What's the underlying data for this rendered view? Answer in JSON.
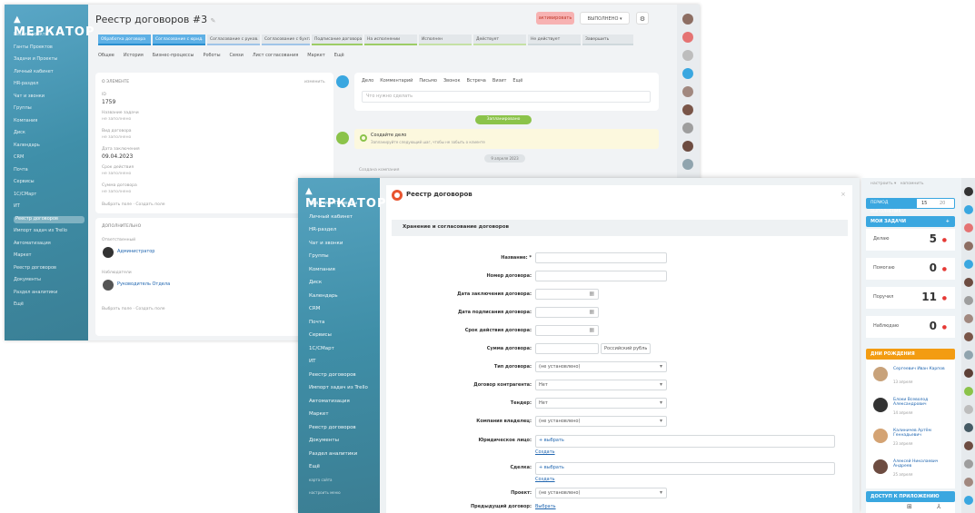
{
  "brand": "МЕРКАТОР",
  "back_window": {
    "sidebar_items": [
      "Наши проекты",
      "Ганты Проектов",
      "Задачи и Проекты",
      "Личный кабинет",
      "HR-раздел",
      "Чат и звонки",
      "Группы",
      "Компания",
      "Диск",
      "Календарь",
      "CRM",
      "Почта",
      "Сервисы",
      "1С/СМарт",
      "ИТ",
      "Реестр договоров",
      "Импорт задач из Trello",
      "Автоматизация",
      "Маркет",
      "Реестр договоров",
      "Документы",
      "Раздел аналитики",
      "Ещё"
    ],
    "title": "Реестр договоров #3",
    "btn_primary": "активировать",
    "btn_secondary": "ВЫПОЛНЕНО",
    "stages": [
      "Обработка договора",
      "Согласование с юрид.",
      "Согласование с руков.",
      "Согласование с бухгал.",
      "Подписание договора",
      "На исполнении",
      "Исполнен",
      "Действует",
      "Не действует",
      "Завершить"
    ],
    "tabs": [
      "Общее",
      "История",
      "Бизнес-процессы",
      "Роботы",
      "Связи",
      "Лист согласования",
      "Маркет",
      "Ещё"
    ],
    "about_header": "О ЭЛЕМЕНТЕ",
    "about_action": "изменить",
    "fields": [
      {
        "label": "ID",
        "value": "1759"
      },
      {
        "label": "Название задачи",
        "value": "не заполнено"
      },
      {
        "label": "Вид договора",
        "value": "не заполнено"
      },
      {
        "label": "Дата заключения",
        "value": "09.04.2023"
      },
      {
        "label": "Срок действия",
        "value": "не заполнено"
      },
      {
        "label": "Сумма договора",
        "value": "не заполнено"
      }
    ],
    "select_fields": "Выбрать поле",
    "create_field": "Создать поле",
    "extra_header": "ДОПОЛНИТЕЛЬНО",
    "responsible_label": "Ответственный",
    "responsible_name": "Администратор",
    "observers_label": "Наблюдатели",
    "observer_name": "Руководитель Отдела",
    "activity_tabs": [
      "Дело",
      "Комментарий",
      "Письмо",
      "Звонок",
      "Встреча",
      "Визит",
      "Ещё"
    ],
    "activity_placeholder": "Что нужно сделать",
    "planned_badge": "Запланировано",
    "create_task_title": "Создайте дело",
    "create_task_hint": "Запланируйте следующий шаг, чтобы не забыть о клиенте",
    "date_badge": "9 апреля 2023",
    "created_text": "Создана компания"
  },
  "front_window": {
    "sidebar_items": [
      "Задачи и Проекты",
      "Личный кабинет",
      "HR-раздел",
      "Чат и звонки",
      "Группы",
      "Компания",
      "Диск",
      "Календарь",
      "CRM",
      "Почта",
      "Сервисы",
      "1С/СМарт",
      "ИТ",
      "Реестр договоров",
      "Импорт задач из Trello",
      "Автоматизация",
      "Маркет",
      "Реестр договоров",
      "Документы",
      "Раздел аналитики",
      "Ещё",
      "карта сайта",
      "настроить меню"
    ],
    "page_title": "Реестр договоров",
    "section_title": "Хранение и согласование договоров",
    "form": {
      "name_label": "Название: *",
      "number_label": "Номер договора:",
      "conclusion_date_label": "Дата заключения договора:",
      "signing_date_label": "Дата подписания договора:",
      "validity_label": "Срок действия договора:",
      "sum_label": "Сумма договора:",
      "currency_value": "Российский рубль",
      "type_label": "Тип договора:",
      "type_value": "(не установлено)",
      "counterparty_label": "Договор контрагента:",
      "counterparty_value": "Нет",
      "tender_label": "Тендер:",
      "tender_value": "Нет",
      "company_label": "Компания владелец:",
      "company_value": "(не установлено)",
      "legal_label": "Юридическое лицо:",
      "legal_select": "+ выбрать",
      "legal_create": "Создать",
      "deal_label": "Сделка:",
      "deal_select": "+ выбрать",
      "deal_create": "Создать",
      "project_label": "Проект:",
      "project_value": "(не установлено)",
      "prev_label": "Предыдущий договор:",
      "prev_link": "Выбрать"
    }
  },
  "right_panel": {
    "top_links": [
      "настроить",
      "напомнить"
    ],
    "time_label": "ПЕРИОД ВЫПОЛНЕНИЯ",
    "time_values": [
      "15",
      "20"
    ],
    "tasks_header": "МОИ ЗАДАЧИ",
    "tasks": [
      {
        "label": "Делаю",
        "count": "5"
      },
      {
        "label": "Помогаю",
        "count": "0"
      },
      {
        "label": "Поручил",
        "count": "11"
      },
      {
        "label": "Наблюдаю",
        "count": "0"
      }
    ],
    "birthdays_header": "ДНИ РОЖДЕНИЯ",
    "birthdays": [
      {
        "name": "Сергеевич Иван Карпов",
        "date": "13 апреля"
      },
      {
        "name": "Блоки Всеволод Александрович",
        "date": "14 апреля"
      },
      {
        "name": "Калиничев Артём Геннадьевич",
        "date": "23 апреля"
      },
      {
        "name": "Алексей Николаевич Андреев",
        "date": "25 апреля"
      }
    ],
    "apps_header": "ДОСТУП К ПРИЛОЖЕНИЮ",
    "colors": {
      "tasks": "#3aa7e0",
      "birthdays": "#f39c12",
      "apps": "#3aa7e0"
    }
  }
}
